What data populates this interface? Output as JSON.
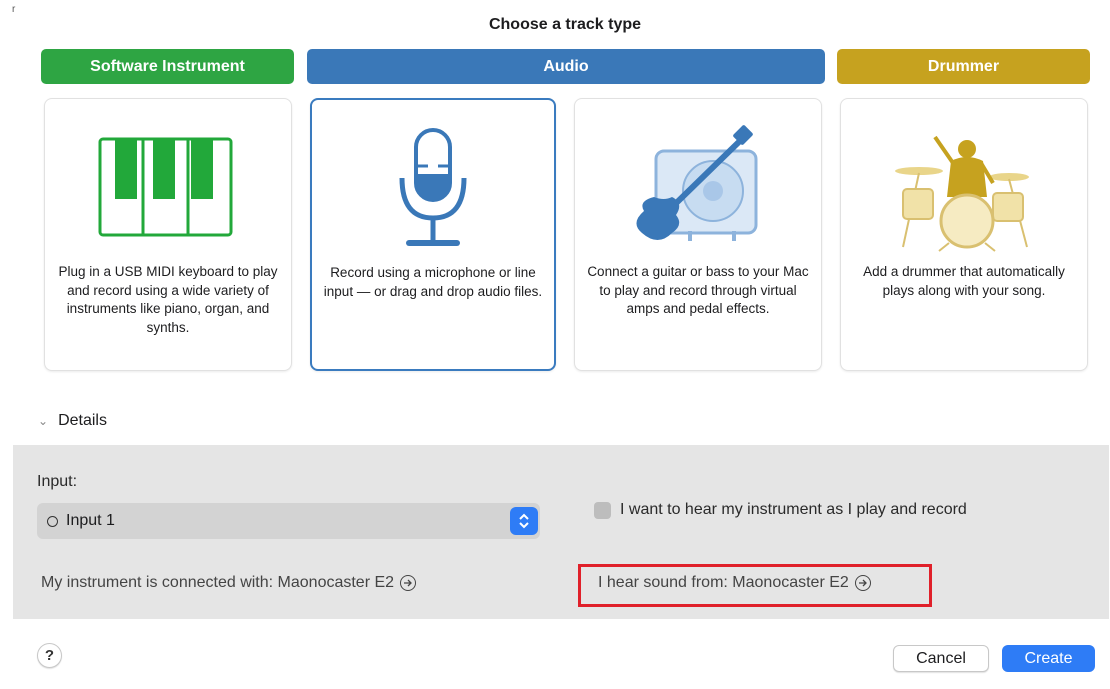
{
  "corner_mark": "r",
  "title": "Choose a track type",
  "track_types": [
    {
      "label": "Software Instrument",
      "color": "#2ea543"
    },
    {
      "label": "Audio",
      "color": "#3a78b8"
    },
    {
      "label": "Drummer",
      "color": "#c6a21f"
    }
  ],
  "cards": [
    {
      "icon": "piano-keyboard-icon",
      "description": "Plug in a USB MIDI keyboard to play and record using a wide variety of instruments like piano, organ, and synths."
    },
    {
      "icon": "microphone-icon",
      "description": "Record using a microphone or line input — or drag and drop audio files.",
      "selected": true
    },
    {
      "icon": "guitar-amp-icon",
      "description": "Connect a guitar or bass to your Mac to play and record through virtual amps and pedal effects."
    },
    {
      "icon": "drummer-icon",
      "description": "Add a drummer that automatically plays along with your song."
    }
  ],
  "details": {
    "label": "Details",
    "input_label": "Input:",
    "input_value": "Input 1",
    "monitor_label": "I want to hear my instrument as I play and record",
    "connected_label": "My instrument is connected with: Maonocaster E2",
    "hear_label": "I hear sound from: Maonocaster E2"
  },
  "footer": {
    "help_label": "?",
    "cancel_label": "Cancel",
    "create_label": "Create"
  },
  "colors": {
    "accent": "#2e7cf6",
    "highlight": "#e0202a"
  }
}
